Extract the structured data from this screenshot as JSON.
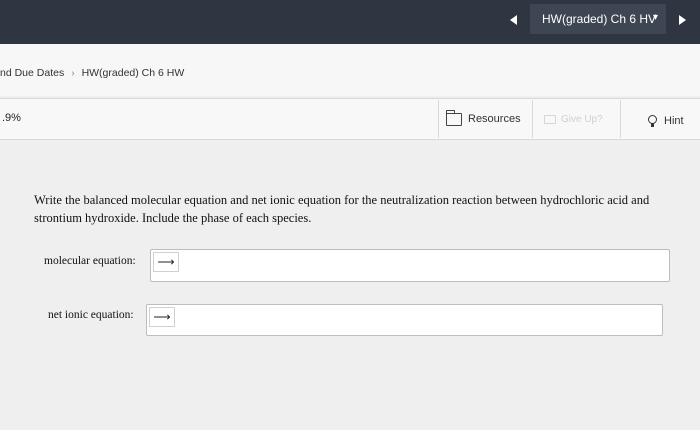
{
  "topbar": {
    "assignment_select": "HW(graded) Ch 6 HV"
  },
  "breadcrumb": {
    "parent": "nd Due Dates",
    "current": "HW(graded) Ch 6 HW"
  },
  "toolbar": {
    "score": ".9%",
    "resources_label": "Resources",
    "give_up_label": "Give Up?",
    "hint_label": "Hint"
  },
  "question": {
    "prompt": "Write the balanced molecular equation and net ionic equation for the neutralization reaction between hydrochloric acid and strontium hydroxide. Include the phase of each species.",
    "molecular_label": "molecular equation:",
    "molecular_value": "⟶",
    "net_ionic_label": "net ionic equation:",
    "net_ionic_value": "⟶"
  },
  "icons": {
    "prev": "triangle-left-icon",
    "next": "triangle-right-icon",
    "dropdown": "chevron-down-icon",
    "resources": "folder-icon",
    "give_up": "flag-icon",
    "hint": "lightbulb-icon"
  }
}
